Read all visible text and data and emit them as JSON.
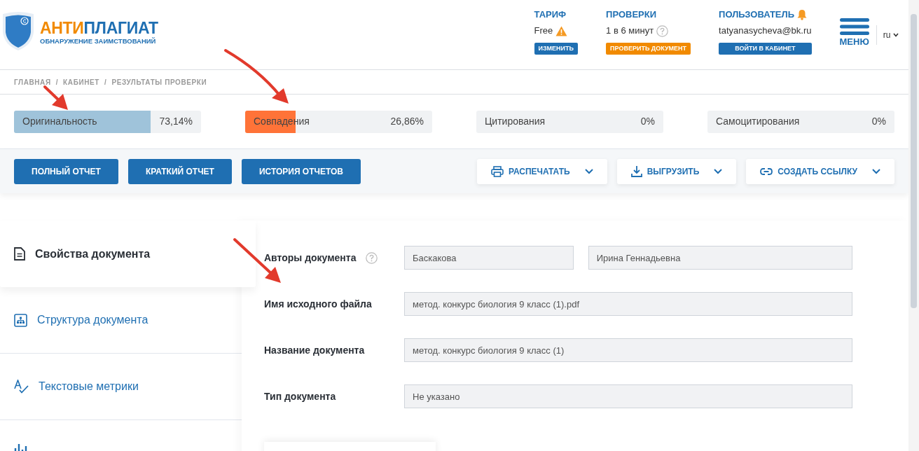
{
  "logo": {
    "title_part1": "АНТИ",
    "title_part2": "ПЛАГИАТ",
    "subtitle": "ОБНАРУЖЕНИЕ ЗАИМСТВОВАНИЙ"
  },
  "header_blocks": [
    {
      "kind": "tariff",
      "title": "ТАРИФ",
      "value": "Free",
      "button": "ИЗМЕНИТЬ"
    },
    {
      "kind": "checks",
      "title": "ПРОВЕРКИ",
      "value": "1 в 6 минут",
      "button": "ПРОВЕРИТЬ ДОКУМЕНТ"
    },
    {
      "kind": "user",
      "title": "ПОЛЬЗОВАТЕЛЬ",
      "value": "tatyanasycheva@bk.ru",
      "button": "ВОЙТИ В КАБИНЕТ"
    }
  ],
  "menu": {
    "label": "МЕНЮ"
  },
  "language": "ru",
  "breadcrumbs": {
    "separator": "/",
    "items": [
      "ГЛАВНАЯ",
      "КАБИНЕТ",
      "РЕЗУЛЬТАТЫ ПРОВЕРКИ"
    ]
  },
  "metrics": [
    {
      "label": "Оригинальность",
      "value": "73,14%",
      "level": 0.7314,
      "color": "#9fc3da"
    },
    {
      "label": "Совпадения",
      "value": "26,86%",
      "level": 0.2686,
      "color": "#ff7338"
    },
    {
      "label": "Цитирования",
      "value": "0%"
    },
    {
      "label": "Самоцитирования",
      "value": "0%"
    }
  ],
  "report_buttons": [
    "ПОЛНЫЙ ОТЧЕТ",
    "КРАТКИЙ ОТЧЕТ",
    "ИСТОРИЯ ОТЧЕТОВ"
  ],
  "actions": [
    {
      "kind": "print",
      "label": "РАСПЕЧАТАТЬ"
    },
    {
      "kind": "download",
      "label": "ВЫГРУЗИТЬ"
    },
    {
      "kind": "link",
      "label": "СОЗДАТЬ ССЫЛКУ"
    }
  ],
  "sidebar": {
    "items": [
      {
        "kind": "properties",
        "label": "Свойства документа",
        "selected": true
      },
      {
        "kind": "structure",
        "label": "Структура документа",
        "selected": false
      },
      {
        "kind": "text_metrics",
        "label": "Текстовые метрики",
        "selected": false
      },
      {
        "kind": "partial",
        "selected": false
      }
    ]
  },
  "properties": [
    {
      "label": "Авторы документа",
      "help": true,
      "values": [
        "Баскакова",
        "Ирина Геннадьевна"
      ]
    },
    {
      "label": "Имя исходного файла",
      "help": false,
      "values": [
        "метод. конкурс биология 9 класс (1).pdf"
      ]
    },
    {
      "label": "Название документа",
      "help": false,
      "values": [
        "метод. конкурс биология 9 класс (1)"
      ]
    },
    {
      "label": "Тип документа",
      "help": false,
      "values": [
        "Не указано"
      ]
    }
  ]
}
